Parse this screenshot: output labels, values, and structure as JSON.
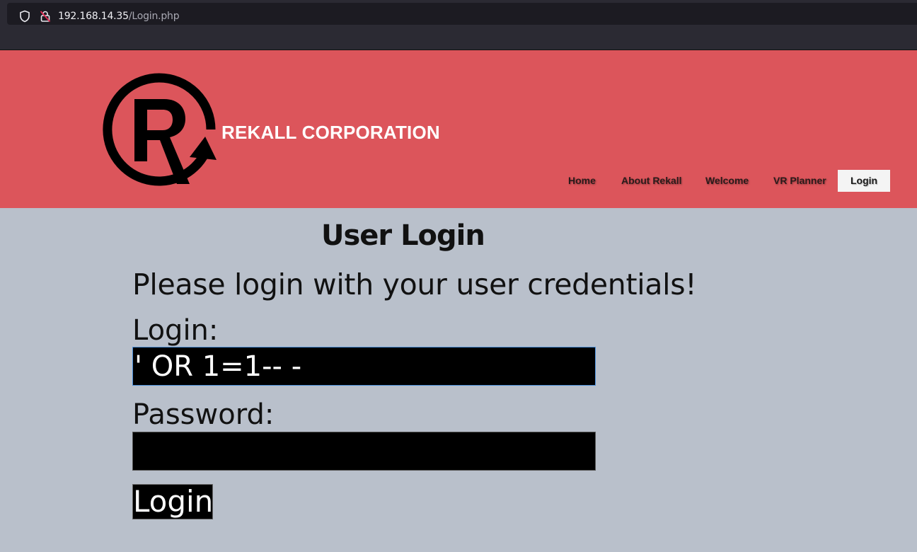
{
  "browser": {
    "url_host": "192.168.14.35",
    "url_path": "/Login.php",
    "icons": [
      "shield-icon",
      "insecure-lock-icon"
    ]
  },
  "header": {
    "brand": "REKALL CORPORATION",
    "logo_icon": "rekall-r-logo",
    "bg_color": "#dc555b",
    "nav": [
      {
        "label": "Home",
        "active": false
      },
      {
        "label": "About Rekall",
        "active": false
      },
      {
        "label": "Welcome",
        "active": false
      },
      {
        "label": "VR Planner",
        "active": false
      },
      {
        "label": "Login",
        "active": true
      }
    ]
  },
  "main": {
    "title": "User Login",
    "subtitle": "Please login with your user credentials!",
    "login_label": "Login:",
    "login_value": "' OR 1=1-- -",
    "password_label": "Password:",
    "password_value": "",
    "submit_label": "Login"
  }
}
